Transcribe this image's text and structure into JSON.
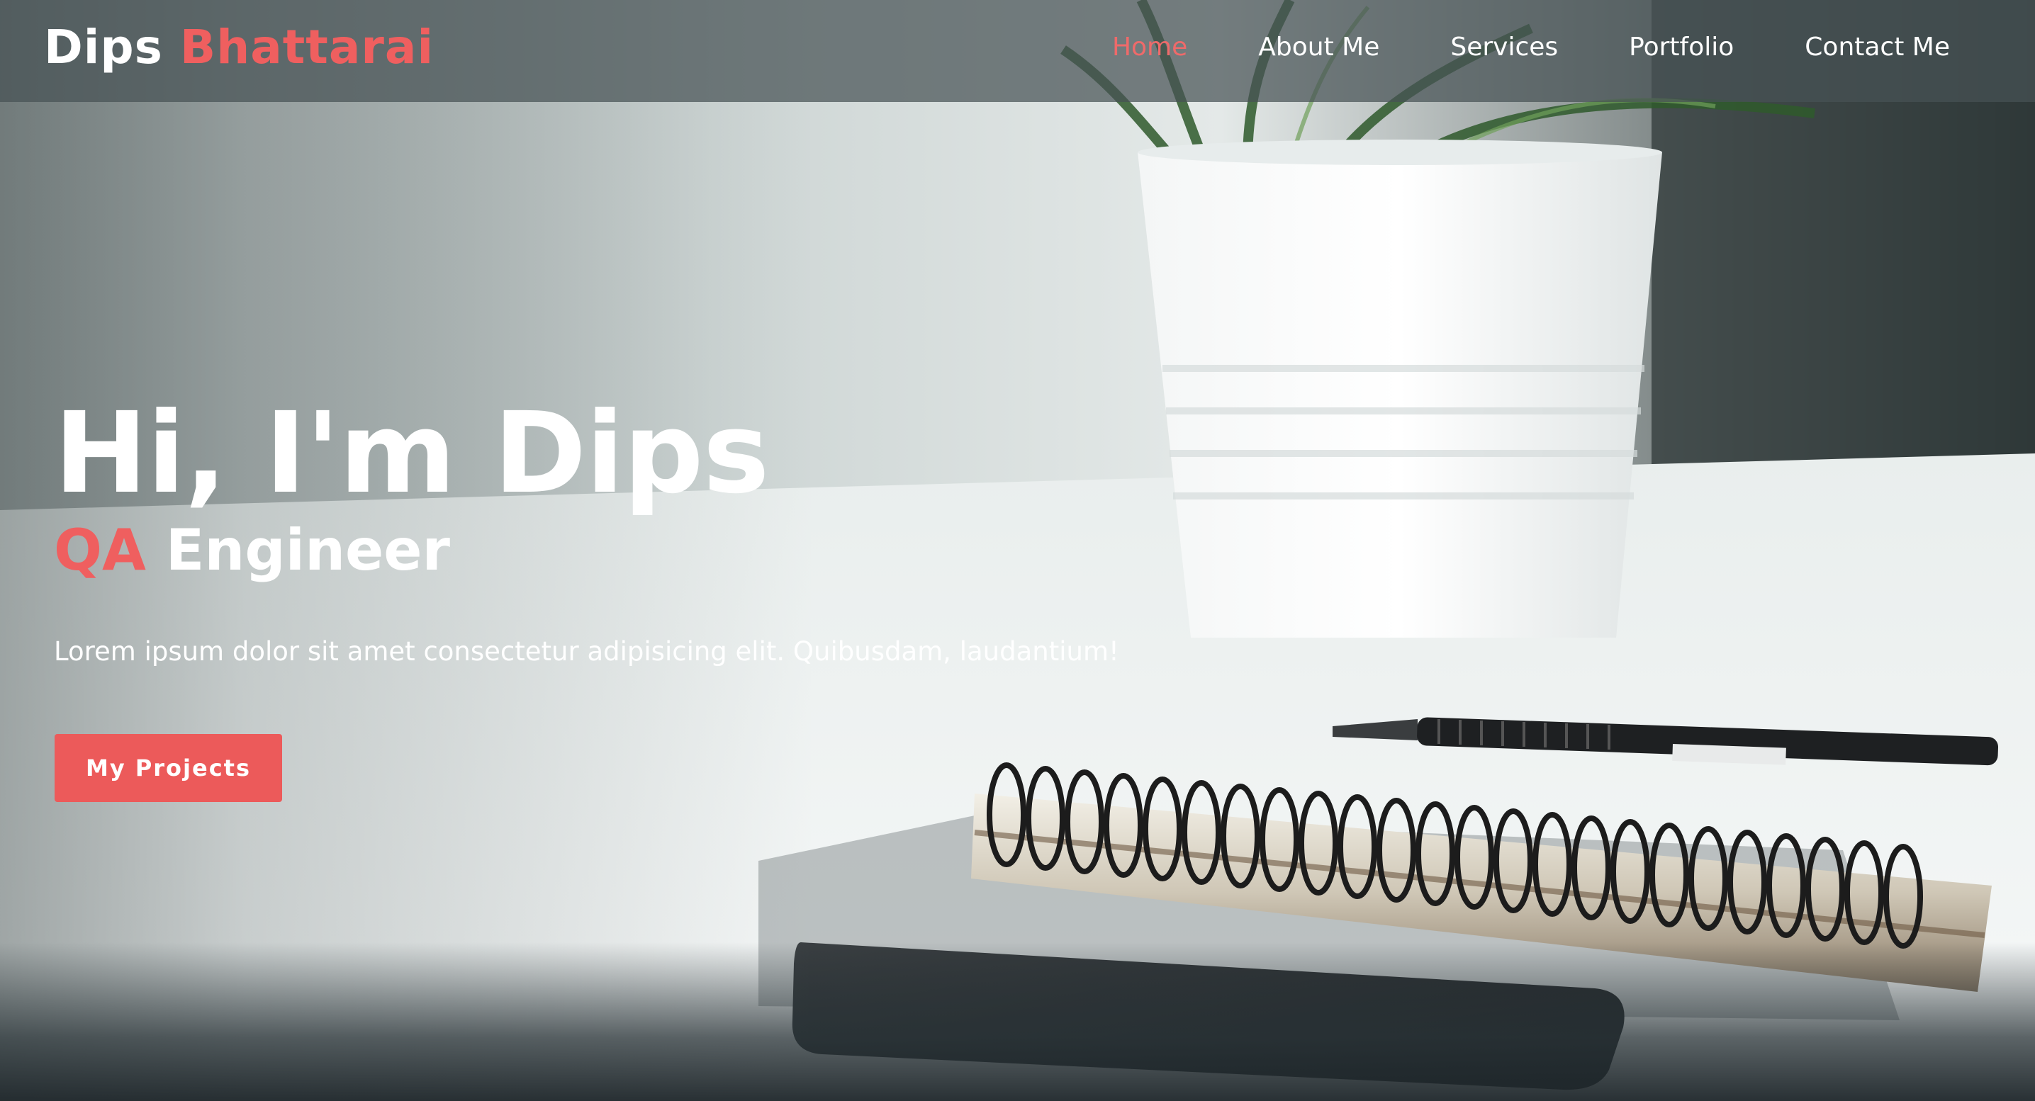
{
  "brand": {
    "first": "Dips",
    "last": "Bhattarai"
  },
  "nav": {
    "items": [
      {
        "label": "Home",
        "active": true
      },
      {
        "label": "About Me",
        "active": false
      },
      {
        "label": "Services",
        "active": false
      },
      {
        "label": "Portfolio",
        "active": false
      },
      {
        "label": "Contact Me",
        "active": false
      }
    ]
  },
  "hero": {
    "title": "Hi, I'm Dips",
    "role_accent": "QA",
    "role_rest": "Engineer",
    "description": "Lorem ipsum dolor sit amet consectetur adipisicing elit. Quibusdam, laudantium!",
    "cta_label": "My Projects"
  },
  "colors": {
    "accent": "#ef5f5f",
    "nav_bg": "#465254",
    "text": "#ffffff"
  }
}
